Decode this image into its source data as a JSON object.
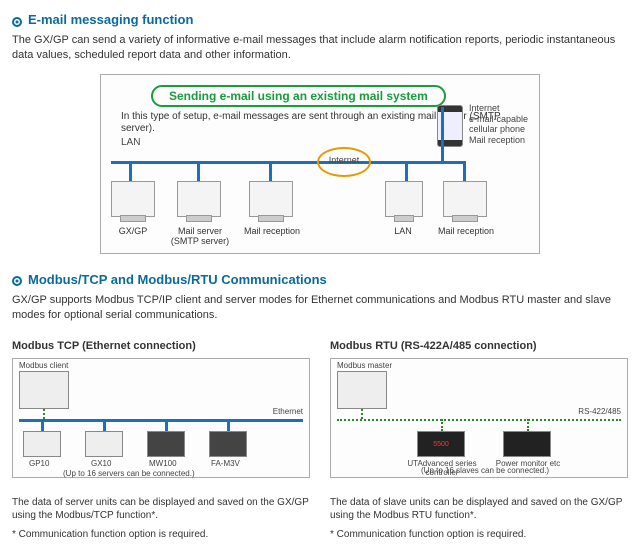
{
  "section1": {
    "title": "E-mail messaging function",
    "intro": "The GX/GP can send a variety of informative e-mail messages that include alarm notification reports, periodic instantaneous data values, scheduled report data and other information.",
    "diagram": {
      "banner": "Sending e-mail using an existing mail system",
      "subtext": "In this type of setup, e-mail messages are sent through an existing mail server (SMTP server).",
      "lan": "LAN",
      "internet": "Internet",
      "nodes": {
        "gxgp": "GX/GP",
        "mailserver": "Mail server\n(SMTP server)",
        "mailrecept1": "Mail reception",
        "lan": "LAN",
        "mailrecept2": "Mail reception"
      },
      "sidephone": "Internet\ne-mail-capable\ncellular phone\nMail reception"
    }
  },
  "section2": {
    "title": "Modbus/TCP and Modbus/RTU Communications",
    "intro": "GX/GP supports Modbus TCP/IP client and server modes for Ethernet communications and Modbus RTU master and slave modes for optional serial communications.",
    "left": {
      "header": "Modbus TCP (Ethernet connection)",
      "labels": {
        "client": "Modbus client",
        "ethernet": "Ethernet",
        "gp10": "GP10",
        "gx10": "GX10",
        "mw100": "MW100",
        "fam3v": "FA-M3V",
        "caption": "(Up to 16 servers can be connected.)"
      },
      "foot1": "The data of server units can be displayed and saved on the GX/GP using the Modbus/TCP function*.",
      "foot2": "* Communication function option is required."
    },
    "right": {
      "header": "Modbus RTU (RS-422A/485 connection)",
      "labels": {
        "master": "Modbus master",
        "bus": "RS-422/485",
        "uta": "UTAdvanced series\ncontroller",
        "pmon": "Power monitor etc",
        "caption": "(Up to 16 slaves can be connected.)"
      },
      "foot1": "The data of slave units can be displayed and saved on the GX/GP using the Modbus RTU function*.",
      "foot2": "* Communication function option is required."
    }
  }
}
